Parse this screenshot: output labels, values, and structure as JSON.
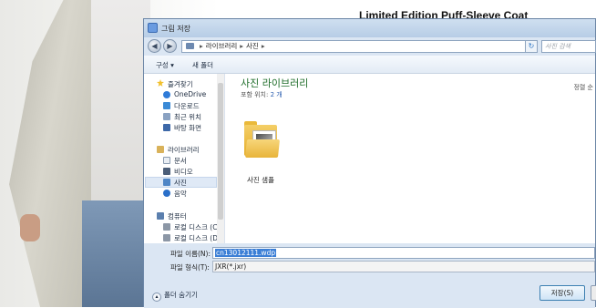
{
  "background": {
    "product_title": "Limited Edition Puff-Sleeve Coat"
  },
  "dialog": {
    "title": "그림 저장",
    "address": {
      "crumbs": [
        "라이브러리",
        "사진"
      ],
      "search_placeholder": "사진 검색"
    },
    "toolbar": {
      "organize": "구성 ▾",
      "new_folder": "새 폴더"
    },
    "nav": {
      "favorites": "즐겨찾기",
      "favorites_items": [
        "OneDrive",
        "다운로드",
        "최근 위치",
        "바탕 화면"
      ],
      "libraries": "라이브러리",
      "libraries_items": [
        "문서",
        "비디오",
        "사진",
        "음악"
      ],
      "selected": "사진",
      "computer": "컴퓨터",
      "computer_items": [
        "로컬 디스크 (C:)",
        "로컬 디스크 (D:)"
      ]
    },
    "main": {
      "library_title": "사진 라이브러리",
      "include_label": "포함 위치:",
      "include_count": "2 개",
      "sort_label": "정렬 순",
      "folder_label": "사진 샘플"
    },
    "bottom": {
      "filename_label": "파일 이름(N):",
      "filename_value": "cn13012111.wdp",
      "filetype_label": "파일 형식(T):",
      "filetype_value": "JXR(*.jxr)",
      "hide_folders": "폴더 숨기기",
      "save_button": "저장(S)"
    }
  }
}
